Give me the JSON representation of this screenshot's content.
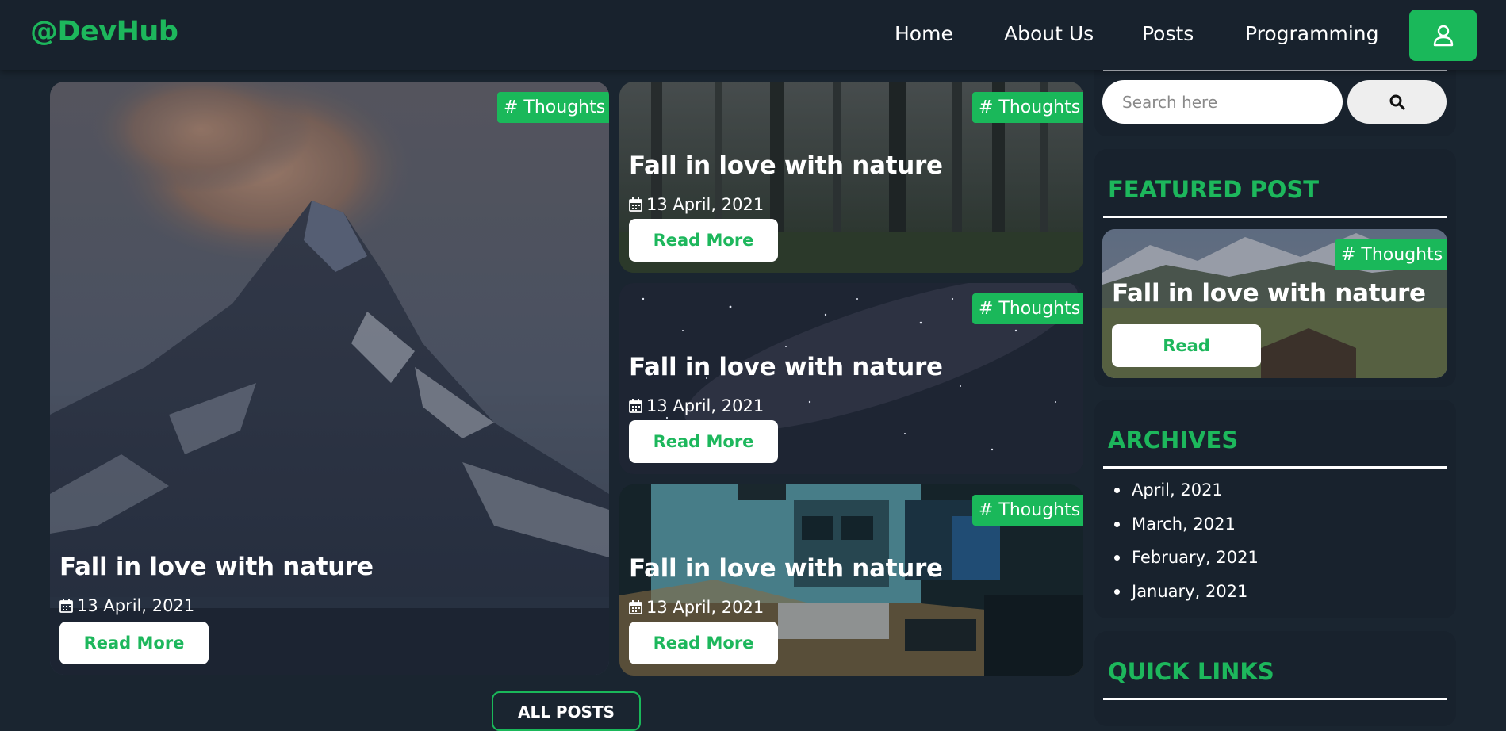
{
  "brand": "@DevHub",
  "nav": {
    "links": [
      "Home",
      "About Us",
      "Posts",
      "Programming"
    ],
    "user_icon": "user-icon"
  },
  "posts": [
    {
      "tag": "# Thoughts",
      "title": "Fall in love with nature",
      "date": "13 April, 2021",
      "button": "Read More",
      "image": "volcanic-mountain"
    },
    {
      "tag": "# Thoughts",
      "title": "Fall in love with nature",
      "date": "13 April, 2021",
      "button": "Read More",
      "image": "misty-forest"
    },
    {
      "tag": "# Thoughts",
      "title": "Fall in love with nature",
      "date": "13 April, 2021",
      "button": "Read More",
      "image": "starry-sky"
    },
    {
      "tag": "# Thoughts",
      "title": "Fall in love with nature",
      "date": "13 April, 2021",
      "button": "Read More",
      "image": "desk-setup"
    }
  ],
  "all_posts_button": "ALL POSTS",
  "sidebar": {
    "search": {
      "placeholder": "Search here",
      "icon": "search-icon"
    },
    "featured": {
      "heading": "FEATURED POST",
      "tag": "# Thoughts",
      "title": "Fall in love with nature",
      "button": "Read"
    },
    "archives": {
      "heading": "ARCHIVES",
      "items": [
        "April, 2021",
        "March, 2021",
        "February, 2021",
        "January, 2021"
      ]
    },
    "quick_links": {
      "heading": "QUICK LINKS"
    }
  },
  "colors": {
    "accent": "#1ab85a",
    "background": "#1a2530",
    "panel": "#18222d",
    "navbar": "#18222d"
  }
}
